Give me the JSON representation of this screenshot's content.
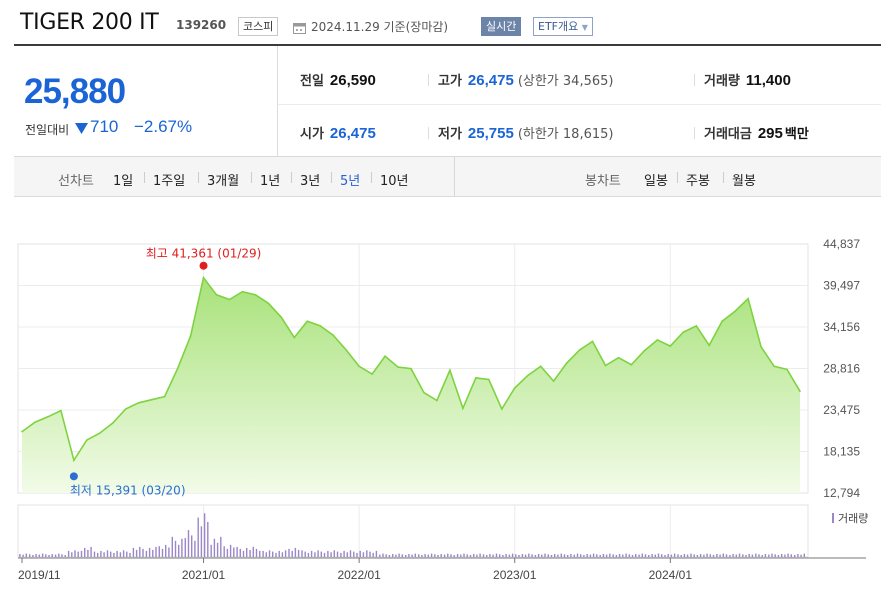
{
  "header": {
    "name": "TIGER 200 IT",
    "code": "139260",
    "market": "코스피",
    "date_info": "2024.11.29 기준(장마감)",
    "live_label": "실시간",
    "etf_label": "ETF개요"
  },
  "quote": {
    "price": "25,880",
    "change_label": "전일대비",
    "change_value": "710",
    "change_rate": "−2.67%",
    "direction": "down",
    "prev_close_label": "전일",
    "prev_close": "26,590",
    "high_label": "고가",
    "high": "26,475",
    "upper_limit_text": "(상한가 34,565)",
    "volume_label": "거래량",
    "volume": "11,400",
    "open_label": "시가",
    "open": "26,475",
    "low_label": "저가",
    "low": "25,755",
    "lower_limit_text": "(하한가 18,615)",
    "amount_label": "거래대금",
    "amount": "295",
    "amount_unit": "백만"
  },
  "tabs": {
    "line_label": "선차트",
    "line_tabs": [
      "1일",
      "1주일",
      "3개월",
      "1년",
      "3년",
      "5년",
      "10년"
    ],
    "active": "5년",
    "candle_label": "봉차트",
    "candle_tabs": [
      "일봉",
      "주봉",
      "월봉"
    ]
  },
  "colors": {
    "price_blue": "#1a64d6",
    "line_green": "#7ed340",
    "fill_top": "#a8e27a",
    "fill_bottom": "#f2fbe8",
    "high_red": "#e21d1d",
    "low_blue": "#2b6fd1",
    "volume_purple": "#9a86c8"
  },
  "chart_data": {
    "type": "area",
    "y_ticks": [
      "44,837",
      "39,497",
      "34,156",
      "28,816",
      "23,475",
      "18,135",
      "12,794"
    ],
    "ylim": [
      12794,
      44837
    ],
    "x_ticks": [
      "2019/11",
      "2021/01",
      "2022/01",
      "2023/01",
      "2024/01"
    ],
    "max_annotation": "최고 41,361 (01/29)",
    "min_annotation": "최저 15,391 (03/20)",
    "volume_label": "거래량",
    "series": [
      {
        "x": [
          "2019-11",
          "2019-12",
          "2020-01",
          "2020-02",
          "2020-03",
          "2020-04",
          "2020-05",
          "2020-06",
          "2020-07",
          "2020-08",
          "2020-09",
          "2020-10",
          "2020-11",
          "2020-12",
          "2021-01",
          "2021-02",
          "2021-03",
          "2021-04",
          "2021-05",
          "2021-06",
          "2021-07",
          "2021-08",
          "2021-09",
          "2021-10",
          "2021-11",
          "2021-12",
          "2022-01",
          "2022-02",
          "2022-03",
          "2022-04",
          "2022-05",
          "2022-06",
          "2022-07",
          "2022-08",
          "2022-09",
          "2022-10",
          "2022-11",
          "2022-12",
          "2023-01",
          "2023-02",
          "2023-03",
          "2023-04",
          "2023-05",
          "2023-06",
          "2023-07",
          "2023-08",
          "2023-09",
          "2023-10",
          "2023-11",
          "2023-12",
          "2024-01",
          "2024-02",
          "2024-03",
          "2024-04",
          "2024-05",
          "2024-06",
          "2024-07",
          "2024-08",
          "2024-09",
          "2024-10",
          "2024-11"
        ],
        "values": [
          20700,
          21900,
          22600,
          23400,
          17000,
          19600,
          20500,
          21800,
          23600,
          24400,
          24800,
          25200,
          28800,
          33000,
          40500,
          38300,
          37700,
          38700,
          38300,
          37200,
          35400,
          32800,
          34900,
          34300,
          33100,
          31200,
          29100,
          28100,
          30400,
          29000,
          28800,
          25700,
          24700,
          28600,
          23700,
          27600,
          27400,
          23600,
          26300,
          27900,
          29100,
          27200,
          29500,
          31200,
          32300,
          29200,
          30200,
          29300,
          31100,
          32500,
          31700,
          33500,
          34300,
          31800,
          34900,
          36200,
          37800,
          31600,
          29100,
          28700,
          25880
        ]
      }
    ],
    "volume": [
      1,
      1,
      1,
      1,
      2,
      3,
      2,
      2,
      2,
      3,
      3,
      4,
      6,
      8,
      13,
      6,
      4,
      3,
      3,
      2,
      2,
      3,
      2,
      2,
      2,
      2,
      2,
      2,
      1,
      1,
      1,
      1,
      1,
      1,
      1,
      1,
      1,
      1,
      1,
      1,
      1,
      1,
      1,
      1,
      1,
      1,
      1,
      1,
      1,
      1,
      1,
      1,
      1,
      1,
      1,
      1,
      1,
      1,
      1,
      1,
      1
    ]
  }
}
